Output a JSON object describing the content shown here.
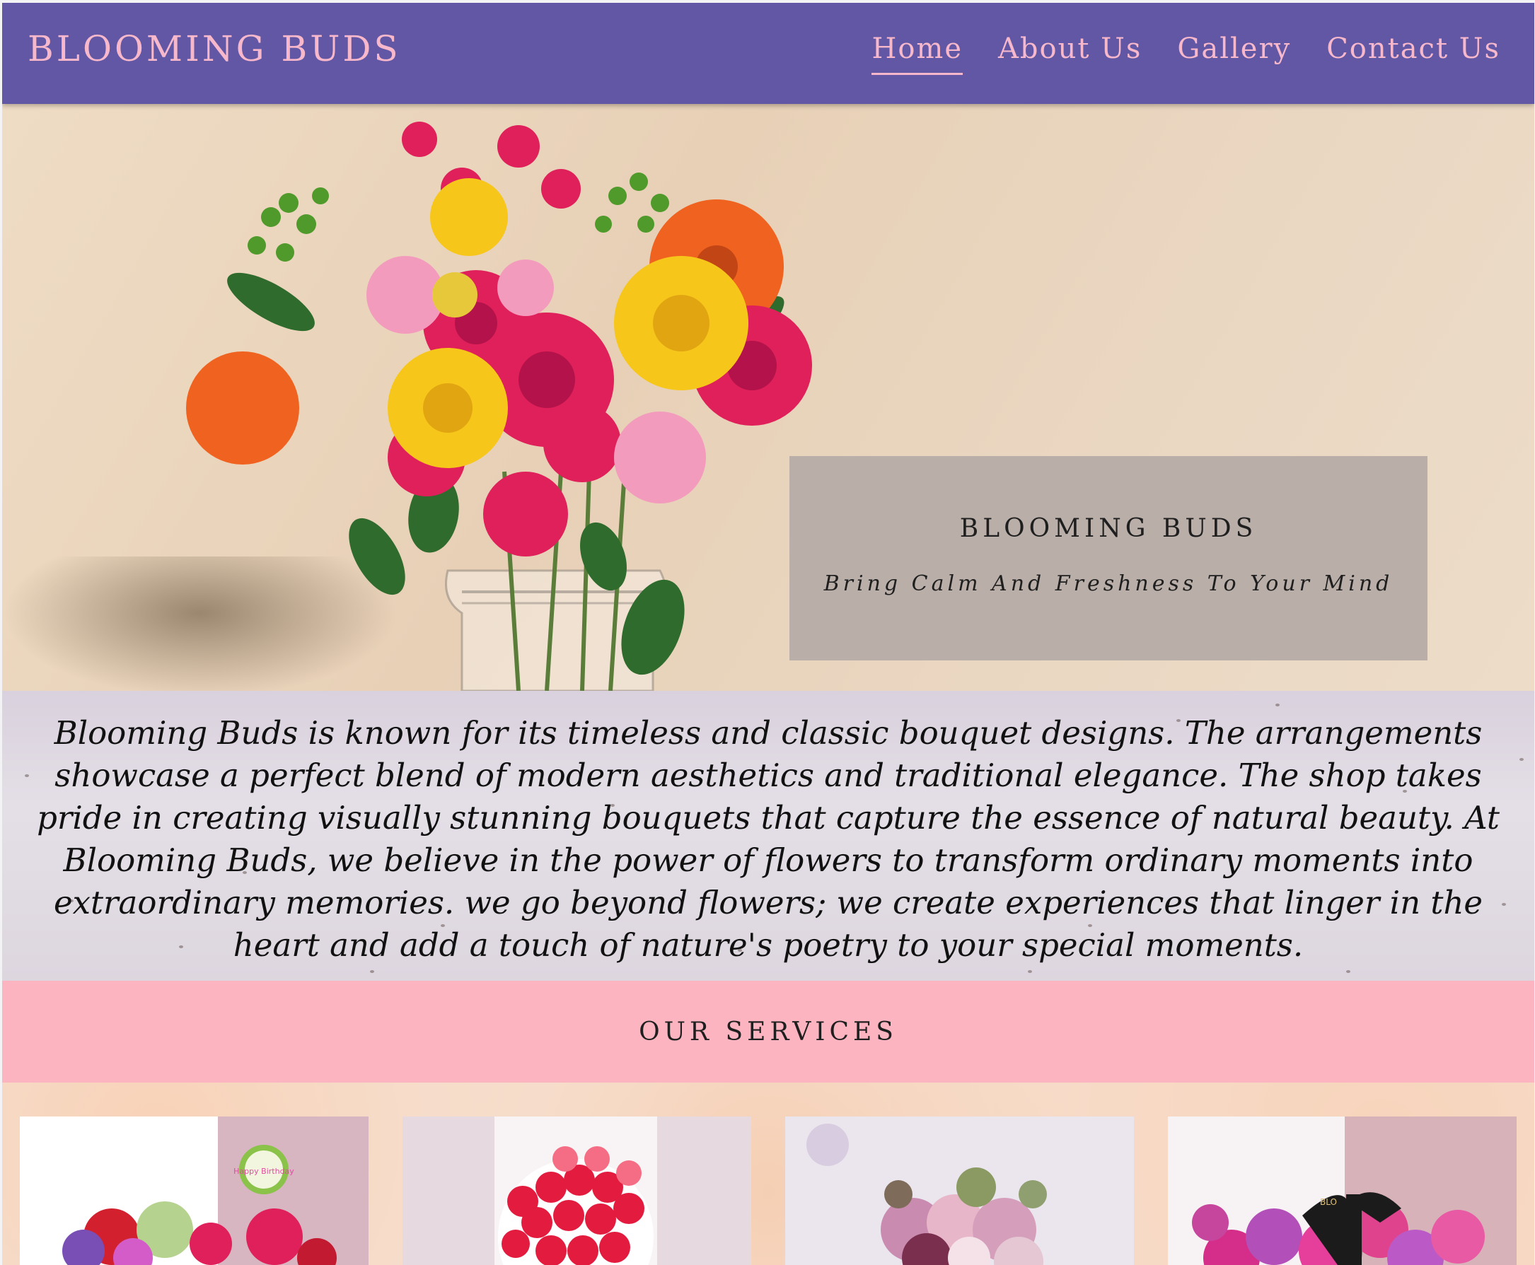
{
  "brand": "BLOOMING BUDS",
  "nav": [
    {
      "label": "Home",
      "active": true
    },
    {
      "label": "About Us"
    },
    {
      "label": "Gallery"
    },
    {
      "label": "Contact Us"
    }
  ],
  "hero": {
    "title": "BLOOMING BUDS",
    "tagline": "Bring Calm And Freshness To Your Mind"
  },
  "about": {
    "text": "Blooming Buds is known for its timeless and classic bouquet designs. The arrangements showcase a perfect blend of modern aesthetics and traditional elegance. The shop takes pride in creating visually stunning bouquets that capture the essence of natural beauty. At Blooming Buds, we believe in the power of flowers to transform ordinary moments into extraordinary memories. we go beyond flowers; we create experiences that linger in the heart and add a touch of nature's poetry to your special moments."
  },
  "services": {
    "title": "OUR SERVICES",
    "cards": [
      {
        "image": "birthday-bouquet-image",
        "badge": "Happy Birthday"
      },
      {
        "image": "red-roses-bouquet-image"
      },
      {
        "image": "pastel-flower-basket-image"
      },
      {
        "image": "gift-box-bouquet-image",
        "ribbon": "BLO"
      }
    ]
  },
  "colors": {
    "navbar": "#6157a4",
    "brand_text": "#f7b8cb",
    "services_band": "#fdb4c1",
    "hero_card": "#b9aea8"
  }
}
